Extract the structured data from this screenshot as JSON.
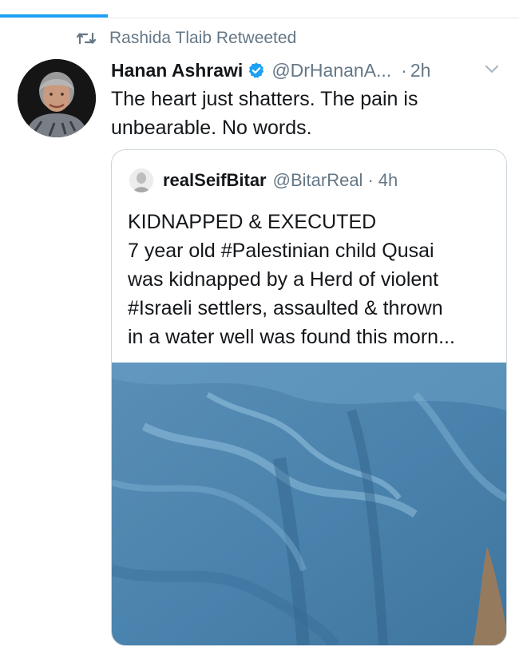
{
  "retweet_banner": {
    "icon": "retweet-icon",
    "text": "Rashida Tlaib Retweeted"
  },
  "tweet": {
    "display_name": "Hanan Ashrawi",
    "verified_icon": "verified-badge-icon",
    "handle": "@DrHananA...",
    "separator": "·",
    "timestamp": "2h",
    "menu_icon": "chevron-down-icon",
    "text_lines": [
      "The heart just shatters. The pain is",
      "unbearable. No words."
    ]
  },
  "quoted_tweet": {
    "display_name": "realSeifBitar",
    "handle": "@BitarReal",
    "separator": "·",
    "timestamp": "4h",
    "text_lines": [
      "KIDNAPPED & EXECUTED",
      "7 year old #Palestinian child Qusai",
      "was kidnapped by a Herd of violent",
      "#Israeli settlers, assaulted & thrown",
      "in a water well was found this morn..."
    ],
    "media_icon": "photo-media"
  },
  "colors": {
    "accent": "#1da1f2",
    "secondary_text": "#657786",
    "primary_text": "#14171a",
    "border": "#ccd6dd"
  }
}
